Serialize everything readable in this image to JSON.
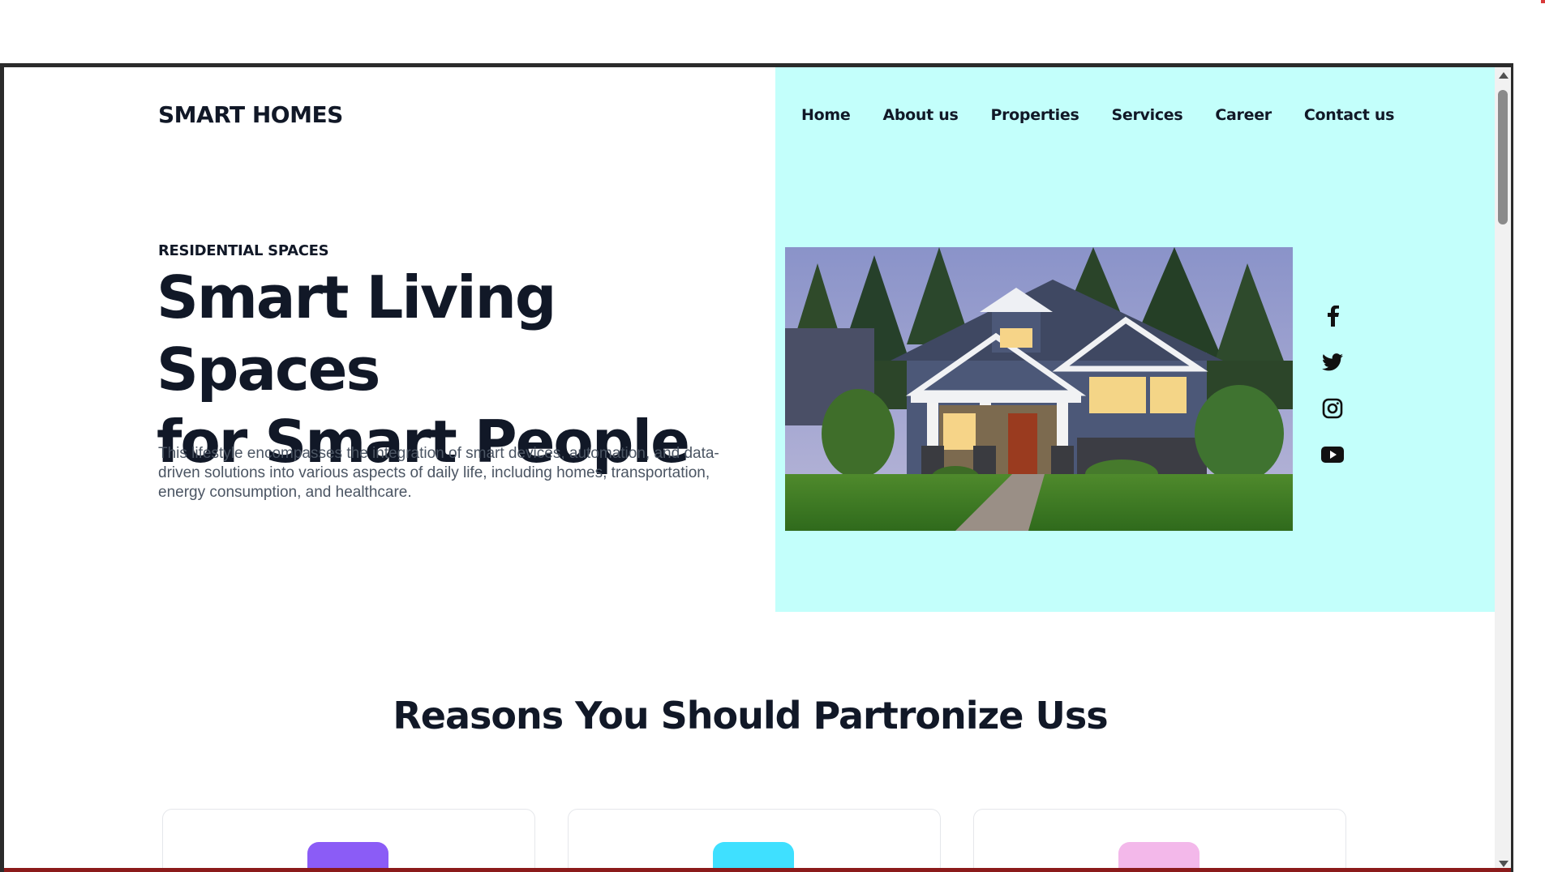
{
  "brand": {
    "logo": "SMART HOMES"
  },
  "nav": {
    "items": [
      {
        "label": "Home"
      },
      {
        "label": "About us"
      },
      {
        "label": "Properties"
      },
      {
        "label": "Services"
      },
      {
        "label": "Career"
      },
      {
        "label": "Contact us"
      }
    ]
  },
  "hero": {
    "eyebrow": "RESIDENTIAL SPACES",
    "headline_line1": "Smart Living Spaces",
    "headline_line2": "for Smart People",
    "description": "This lifestyle encompasses the integration of smart devices, automation, and data-driven solutions into various aspects of daily life, including homes, transportation, energy consumption, and healthcare.",
    "image": "house-photo",
    "accent_color": "#c3fffb"
  },
  "social": [
    "facebook-icon",
    "twitter-icon",
    "instagram-icon",
    "youtube-icon"
  ],
  "reasons": {
    "title": "Reasons You Should Partronize Uss",
    "cards": [
      {
        "badge_color": "#8b5cf6"
      },
      {
        "badge_color": "#3fe0ff"
      },
      {
        "badge_color": "#f3b8ea"
      }
    ]
  }
}
